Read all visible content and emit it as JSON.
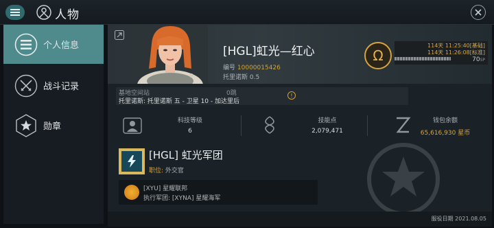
{
  "header": {
    "title": "人物"
  },
  "sidebar": {
    "items": [
      {
        "label": "个人信息",
        "icon": "list-icon",
        "active": true
      },
      {
        "label": "战斗记录",
        "icon": "crossed-swords-icon",
        "active": false
      },
      {
        "label": "勋章",
        "icon": "star-badge-icon",
        "active": false
      }
    ]
  },
  "profile": {
    "name": "[HGL]虹光—红心",
    "id_label": "编号",
    "id_value": "10000015426",
    "location": "托里诺斯 0.5",
    "clone_time_1": "114天 11:25:40[基础]",
    "clone_time_2": "114天 11:26:08[标准]",
    "sp_value": "70",
    "sp_unit": "SP",
    "sp_progress": 1.0
  },
  "station": {
    "label": "基地空间站",
    "jumps": "0跳",
    "path": "托里诺斯: 托里诺斯 五 - 卫星 10 - 加达里后"
  },
  "stats": {
    "tech_label": "科技等级",
    "tech_value": "6",
    "skill_label": "技能点",
    "skill_value": "2,079,471",
    "wallet_label": "钱包余额",
    "wallet_value": "65,616,930 星币"
  },
  "corp": {
    "name": "[HGL] 虹光军团",
    "role_label": "职位:",
    "role_value": "外交官",
    "alliance_name": "[XYU] 星耀联邦",
    "exec_corp": "执行军团: [XYNA] 星耀海军"
  },
  "footer": {
    "service_date": "服役日期 2021.08.05"
  },
  "colors": {
    "accent": "#4f8a8c",
    "gold": "#d7a53c"
  }
}
